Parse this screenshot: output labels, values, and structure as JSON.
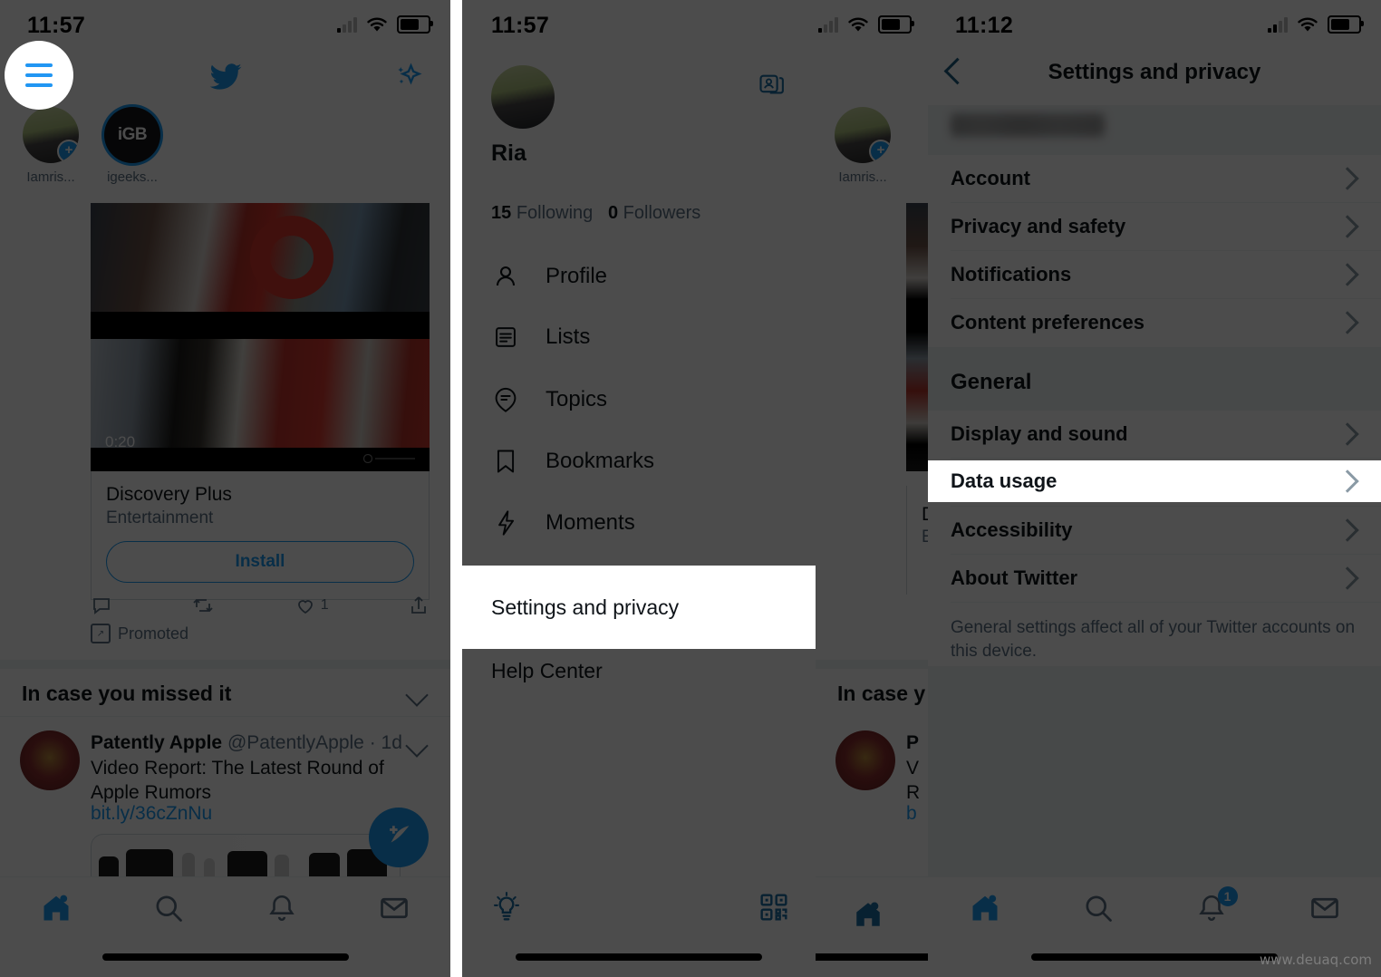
{
  "meta": {
    "watermark": "www.deuaq.com"
  },
  "panel1": {
    "name": "twitter-home-feed",
    "status": {
      "time": "11:57"
    },
    "topbar": {
      "logo": "twitter-bird-icon",
      "sparkle": "sparkle-icon",
      "menu": "hamburger-menu-icon"
    },
    "fleets": [
      {
        "name": "Iamris...",
        "type": "own-fleet"
      },
      {
        "name": "igeeks...",
        "initials": "iGB",
        "type": "fleet"
      }
    ],
    "promoted_tweet": {
      "video_duration": "0:20",
      "app_title": "Discovery Plus",
      "app_category": "Entertainment",
      "install_label": "Install",
      "like_count": "1",
      "promoted_label": "Promoted"
    },
    "icymi": {
      "header": "In case you missed it"
    },
    "tweet": {
      "author": "Patently Apple",
      "handle": "@PatentlyApple",
      "separator": "·",
      "time": "1d",
      "text": "Video Report: The Latest Round of Apple Rumors",
      "link": "bit.ly/36cZnNu"
    },
    "tabbar": [
      {
        "name": "home-tab",
        "icon": "home-icon",
        "active": true
      },
      {
        "name": "search-tab",
        "icon": "search-icon",
        "active": false
      },
      {
        "name": "notifications-tab",
        "icon": "bell-icon",
        "active": false
      },
      {
        "name": "messages-tab",
        "icon": "envelope-icon",
        "active": false
      }
    ]
  },
  "panel2": {
    "name": "twitter-side-drawer",
    "status": {
      "time": "11:57"
    },
    "account": {
      "display_name": "Ria",
      "following_count": "15",
      "following_label": "Following",
      "followers_count": "0",
      "followers_label": "Followers",
      "switch_account_icon": "account-switch-icon"
    },
    "menu_items": [
      {
        "label": "Profile",
        "icon": "person-icon"
      },
      {
        "label": "Lists",
        "icon": "list-icon"
      },
      {
        "label": "Topics",
        "icon": "topic-bubble-icon"
      },
      {
        "label": "Bookmarks",
        "icon": "bookmark-icon"
      },
      {
        "label": "Moments",
        "icon": "lightning-icon"
      }
    ],
    "footer_items": [
      {
        "label": "Settings and privacy",
        "highlighted": true
      },
      {
        "label": "Help Center",
        "highlighted": false
      }
    ],
    "bottom_icons": [
      {
        "name": "display-mode-icon",
        "icon": "lightbulb-icon"
      },
      {
        "name": "qr-code-icon",
        "icon": "qrcode-icon"
      }
    ]
  },
  "panel3": {
    "name": "settings-and-privacy",
    "status": {
      "time": "11:12"
    },
    "header": {
      "title": "Settings and privacy",
      "back_icon": "back-chevron-icon"
    },
    "account_username": "",
    "rows": [
      {
        "label": "Account",
        "highlighted": false
      },
      {
        "label": "Privacy and safety",
        "highlighted": false
      },
      {
        "label": "Notifications",
        "highlighted": false
      },
      {
        "label": "Content preferences",
        "highlighted": false
      }
    ],
    "group_title": "General",
    "general_rows": [
      {
        "label": "Display and sound",
        "highlighted": false
      },
      {
        "label": "Data usage",
        "highlighted": true
      },
      {
        "label": "Accessibility",
        "highlighted": false
      },
      {
        "label": "About Twitter",
        "highlighted": false
      }
    ],
    "note": "General settings affect all of your Twitter accounts on this device.",
    "tabbar": [
      {
        "name": "home-tab",
        "icon": "home-icon",
        "active": true,
        "badge": ""
      },
      {
        "name": "search-tab",
        "icon": "search-icon",
        "active": false,
        "badge": ""
      },
      {
        "name": "notifications-tab",
        "icon": "bell-icon",
        "active": false,
        "badge": "1"
      },
      {
        "name": "messages-tab",
        "icon": "envelope-icon",
        "active": false,
        "badge": ""
      }
    ]
  },
  "colors": {
    "twitter_blue": "#1d9bf0",
    "text_primary": "#0f1419",
    "text_secondary": "#5b7083",
    "divider": "#eff3f4",
    "dim_overlay": "#4d4d4d"
  }
}
